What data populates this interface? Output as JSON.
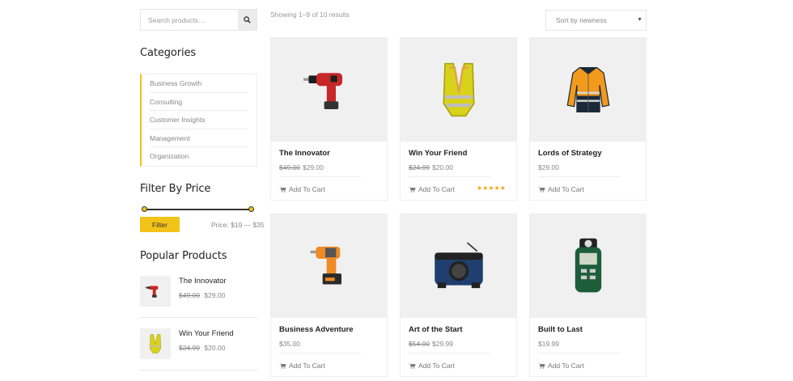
{
  "sidebar": {
    "search": {
      "placeholder": "Search products…",
      "icon": "search-icon"
    },
    "categories": {
      "title": "Categories",
      "items": [
        "Business Growth",
        "Consulting",
        "Customer Insights",
        "Management",
        "Organization"
      ],
      "accent_color": "#f2c318"
    },
    "filter": {
      "title": "Filter By Price",
      "button_label": "Filter",
      "price_label": "Price: $19 — $35",
      "min": 19,
      "max": 35
    },
    "popular": {
      "title": "Popular Products",
      "items": [
        {
          "name": "The Innovator",
          "old_price": "$49.00",
          "price": "$29.00",
          "icon": "drill-icon"
        },
        {
          "name": "Win Your Friend",
          "old_price": "$24.99",
          "price": "$20.00",
          "icon": "safety-vest-icon"
        }
      ]
    }
  },
  "main": {
    "result_count": "Showing 1–9 of 10 results",
    "sort": {
      "selected": "Sort by newness"
    },
    "add_to_cart_label": "Add To Cart",
    "products": [
      {
        "name": "The Innovator",
        "old_price": "$49.00",
        "price": "$29.00",
        "icon": "drill-icon",
        "stars": ""
      },
      {
        "name": "Win Your Friend",
        "old_price": "$24.99",
        "price": "$20.00",
        "icon": "safety-vest-icon",
        "stars": "★★★★★"
      },
      {
        "name": "Lords of Strategy",
        "old_price": "",
        "price": "$29.00",
        "icon": "jacket-icon",
        "stars": ""
      },
      {
        "name": "Business Adventure",
        "old_price": "",
        "price": "$35.00",
        "icon": "power-drill-icon",
        "stars": ""
      },
      {
        "name": "Art of the Start",
        "old_price": "$54.00",
        "price": "$29.99",
        "icon": "radio-icon",
        "stars": ""
      },
      {
        "name": "Built to Last",
        "old_price": "",
        "price": "$19.99",
        "icon": "light-meter-icon",
        "stars": ""
      }
    ]
  }
}
